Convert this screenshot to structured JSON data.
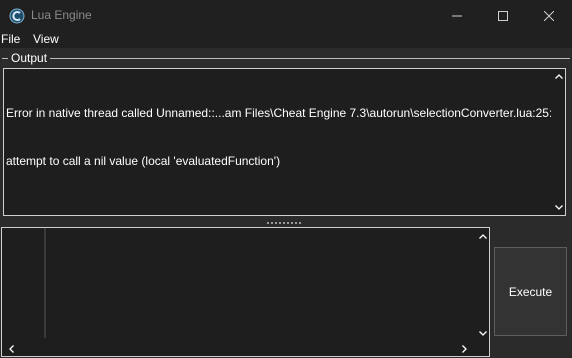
{
  "window": {
    "title": "Lua Engine",
    "icons": {
      "app": "cheat-engine-icon",
      "minimize": "minimize-icon",
      "maximize": "maximize-icon",
      "close": "close-icon"
    }
  },
  "menu": {
    "file": "File",
    "view": "View"
  },
  "output": {
    "label": "Output",
    "line1": "Error in native thread called Unnamed::...am Files\\Cheat Engine 7.3\\autorun\\selectionConverter.lua:25:",
    "line2": "attempt to call a nil value (local 'evaluatedFunction')"
  },
  "editor": {
    "content": ""
  },
  "buttons": {
    "execute": "Execute"
  },
  "colors": {
    "background": "#2b2b2b",
    "titlebar": "#202020",
    "panel": "#1e1e1e",
    "text": "#ffffff",
    "border": "#cfcfcf"
  }
}
